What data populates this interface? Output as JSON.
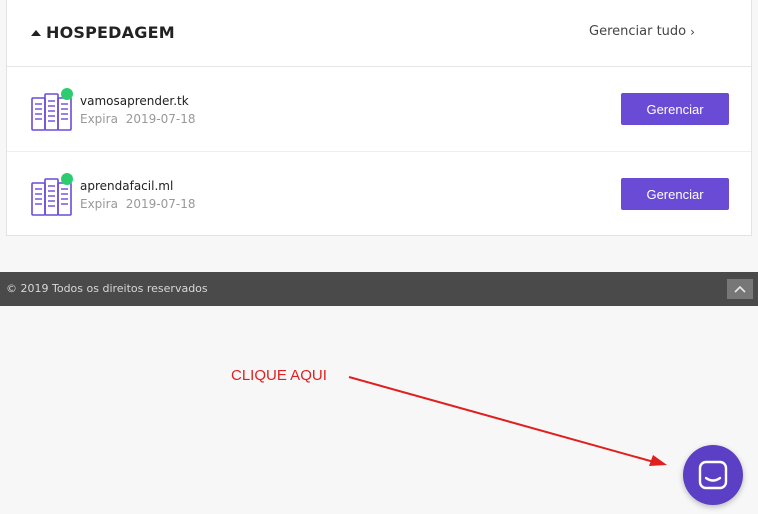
{
  "hosting": {
    "title": "HOSPEDAGEM",
    "manage_all": "Gerenciar tudo",
    "items": [
      {
        "domain": "vamosaprender.tk",
        "expires_label": "Expira",
        "expires_date": "2019-07-18",
        "button": "Gerenciar",
        "status": "active"
      },
      {
        "domain": "aprendafacil.ml",
        "expires_label": "Expira",
        "expires_date": "2019-07-18",
        "button": "Gerenciar",
        "status": "active"
      }
    ]
  },
  "footer": {
    "copyright": "© 2019 Todos os direitos reservados"
  },
  "annotation": {
    "text": "CLIQUE AQUI"
  },
  "icons": {
    "collapse": "caret-up-icon",
    "manage_all": "chevron-right-icon",
    "server": "server-icon",
    "status": "status-dot-icon",
    "back_to_top": "chevron-up-icon",
    "chat": "chat-icon"
  },
  "colors": {
    "accent": "#6a4bd6",
    "status_active": "#2ecc71",
    "footer_bg": "#4a4a4a",
    "annotation": "#e02020",
    "chat_bg": "#5b3fc4"
  }
}
